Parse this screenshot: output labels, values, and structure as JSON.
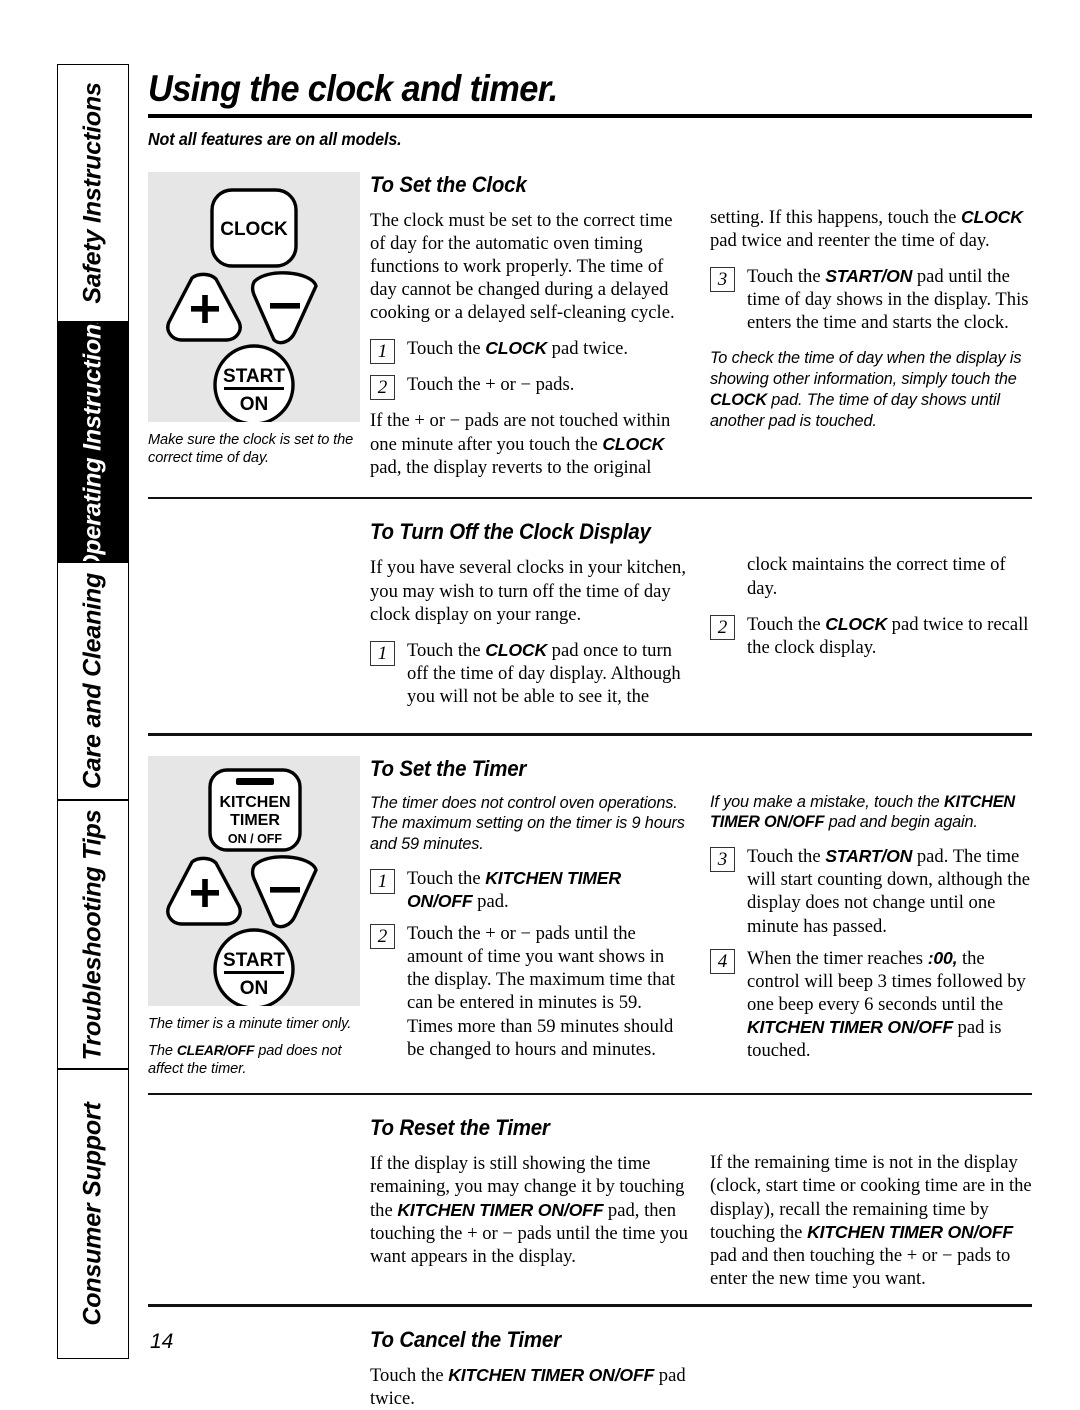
{
  "sidebar": {
    "tabs": [
      {
        "label": "Safety Instructions",
        "active": false
      },
      {
        "label": "Operating Instructions",
        "active": true
      },
      {
        "label": "Care and Cleaning",
        "active": false
      },
      {
        "label": "Troubleshooting Tips",
        "active": false
      },
      {
        "label": "Consumer Support",
        "active": false
      }
    ]
  },
  "page": {
    "title": "Using the clock and timer.",
    "subnote": "Not all features are on all models.",
    "number": "14"
  },
  "illustrations": {
    "clock": {
      "pad_clock": "CLOCK",
      "pad_plus": "+",
      "pad_minus": "−",
      "pad_start": "START",
      "pad_on": "ON",
      "caption": "Make sure the clock is set to the correct time of day."
    },
    "timer": {
      "pad_kitchen": "KITCHEN",
      "pad_timer": "TIMER",
      "pad_onoff": "ON / OFF",
      "pad_plus": "+",
      "pad_minus": "−",
      "pad_start": "START",
      "pad_on": "ON",
      "caption1": "The timer is a minute timer only.",
      "caption2_pre": "The ",
      "caption2_pad": "CLEAR/OFF",
      "caption2_post": " pad does not affect the timer."
    }
  },
  "sections": {
    "set_clock": {
      "heading": "To Set the Clock",
      "intro": "The clock must be set to the correct time of day for the automatic oven timing functions to work properly. The time of day cannot be changed during a delayed cooking or a delayed self-cleaning cycle.",
      "step1_num": "1",
      "step1_pre": "Touch the ",
      "step1_pad": "CLOCK",
      "step1_post": " pad twice.",
      "step2_num": "2",
      "step2_text": "Touch the + or − pads.",
      "tail_pre": "If the + or − pads are not touched within one minute after you touch the ",
      "tail_pad": "CLOCK",
      "tail_post": " pad, the display reverts to the original",
      "right_cont_pre": "setting. If this happens, touch the ",
      "right_cont_pad": "CLOCK",
      "right_cont_post": " pad twice and reenter the time of day.",
      "step3_num": "3",
      "step3_pre": "Touch the ",
      "step3_pad": "START/ON",
      "step3_post": " pad until the time of day shows in the display. This enters the time and starts the clock.",
      "note_pre": "To check the time of day when the display is showing other information, simply touch the ",
      "note_pad": "CLOCK",
      "note_post": " pad. The time of day shows until another pad is touched."
    },
    "turn_off_clock": {
      "heading": "To Turn Off the Clock Display",
      "intro": "If you have several clocks in your kitchen, you may wish to turn off the time of day clock display on your range.",
      "step1_num": "1",
      "step1_pre": "Touch the ",
      "step1_pad": "CLOCK",
      "step1_post": " pad once to turn off the time of day display. Although you will not be able to see it, the",
      "right_cont": "clock maintains the correct time of day.",
      "step2_num": "2",
      "step2_pre": "Touch the ",
      "step2_pad": "CLOCK",
      "step2_post": " pad twice to recall the clock display."
    },
    "set_timer": {
      "heading": "To Set the Timer",
      "note": "The timer does not control oven operations. The maximum setting on the timer is 9 hours and 59 minutes.",
      "step1_num": "1",
      "step1_pre": "Touch the ",
      "step1_pad": "KITCHEN TIMER ON/OFF",
      "step1_post": " pad.",
      "step2_num": "2",
      "step2_text": "Touch the + or − pads until the amount of time you want shows in the display. The maximum time that can be entered in minutes is 59. Times more than 59 minutes should be changed to hours and minutes.",
      "right_note_pre": "If you make a mistake, touch the ",
      "right_note_pad": "KITCHEN TIMER ON/OFF",
      "right_note_post": " pad and begin again.",
      "step3_num": "3",
      "step3_pre": "Touch the ",
      "step3_pad": "START/ON",
      "step3_post": " pad. The time will start counting down, although the display does not change until one minute has passed.",
      "step4_num": "4",
      "step4_pre": "When the timer reaches ",
      "step4_bold": ":00,",
      "step4_mid": " the control will beep 3 times followed by one beep every 6 seconds until the ",
      "step4_pad": "KITCHEN TIMER ON/OFF",
      "step4_post": " pad is touched."
    },
    "reset_timer": {
      "heading": "To Reset the Timer",
      "left_pre": "If the display is still showing the time remaining, you may change it by touching the ",
      "left_pad": "KITCHEN TIMER ON/OFF",
      "left_post": " pad, then touching the + or − pads until the time you want appears in the display.",
      "right_pre": "If the remaining time is not in the display (clock, start time or cooking time are in the display), recall the remaining time by touching the ",
      "right_pad": "KITCHEN TIMER ON/OFF",
      "right_post": " pad and then touching the + or − pads to enter the new time you want."
    },
    "cancel_timer": {
      "heading": "To Cancel the Timer",
      "text_pre": "Touch the ",
      "text_pad": "KITCHEN TIMER ON/OFF",
      "text_post": " pad twice."
    }
  }
}
